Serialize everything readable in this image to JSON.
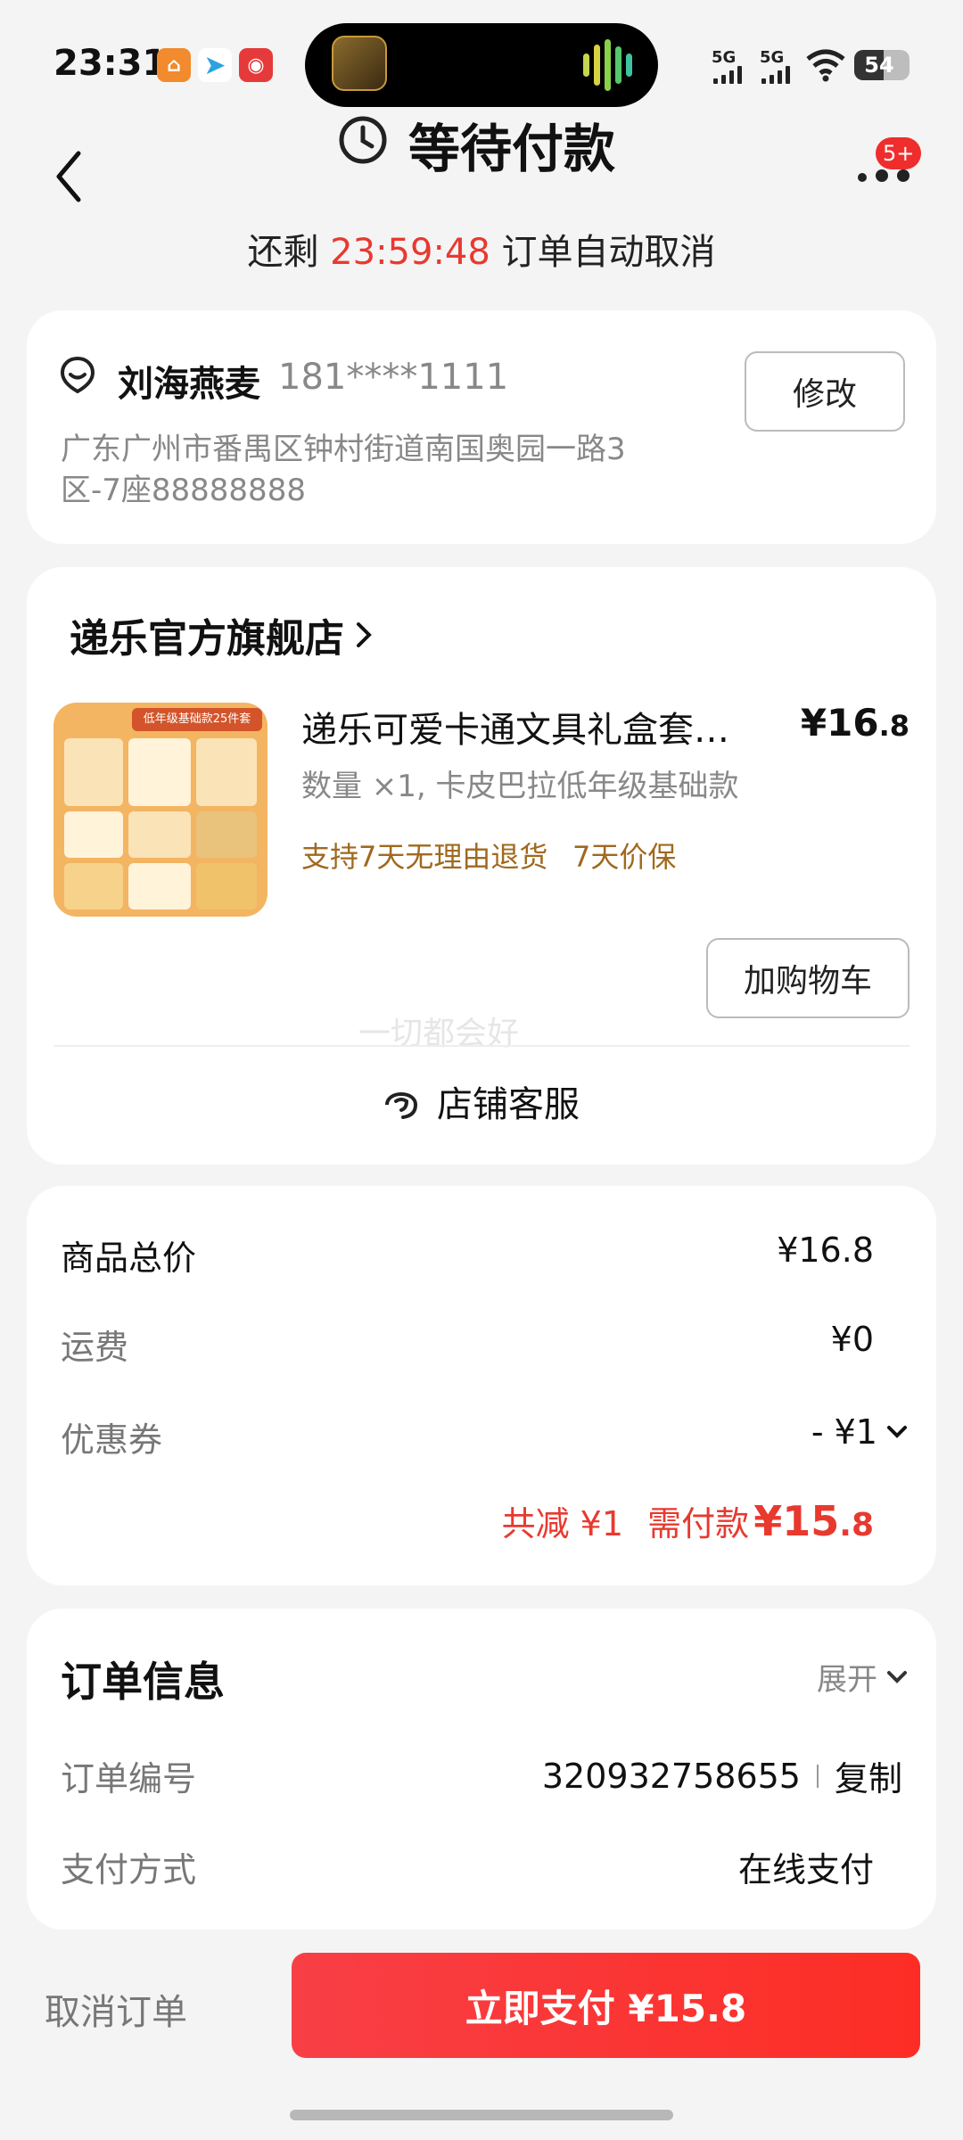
{
  "status_bar": {
    "time": "23:31",
    "signal_1": "5G",
    "signal_2": "5G",
    "battery": "54"
  },
  "header": {
    "title": "等待付款",
    "countdown_prefix": "还剩",
    "countdown_time": "23:59:48",
    "countdown_suffix": "订单自动取消",
    "badge": "5+"
  },
  "address": {
    "name": "刘海燕麦",
    "phone": "181****1111",
    "line1": "广东广州市番禺区钟村街道南国奥园一路3",
    "line2": "区-7座88888888",
    "edit_label": "修改"
  },
  "store": {
    "name": "递乐官方旗舰店",
    "product": {
      "title": "递乐可爱卡通文具礼盒套…",
      "price_int": "¥16",
      "price_dec": ".8",
      "spec": "数量 ×1, 卡皮巴拉低年级基础款",
      "tag1": "支持7天无理由退货",
      "tag2": "7天价保",
      "image_banner": "低年级基础款25件套"
    },
    "add_cart_label": "加购物车",
    "watermark": "一切都会好",
    "service_label": "店铺客服"
  },
  "price": {
    "total_label": "商品总价",
    "total_value": "¥16.8",
    "shipping_label": "运费",
    "shipping_value": "¥0",
    "coupon_label": "优惠券",
    "coupon_value": "- ¥1",
    "discount_text": "共减 ¥1",
    "need_pay_label": "需付款",
    "need_pay_int": "¥15",
    "need_pay_dec": ".8"
  },
  "order_info": {
    "title": "订单信息",
    "expand_label": "展开",
    "order_no_label": "订单编号",
    "order_no_value": "320932758655",
    "copy_label": "复制",
    "pay_method_label": "支付方式",
    "pay_method_value": "在线支付"
  },
  "bottom": {
    "cancel_label": "取消订单",
    "pay_label": "立即支付 ¥15.8"
  },
  "colors": {
    "accent_red": "#e8392f",
    "tag_brown": "#a0691e",
    "background": "#f4f4f4"
  }
}
